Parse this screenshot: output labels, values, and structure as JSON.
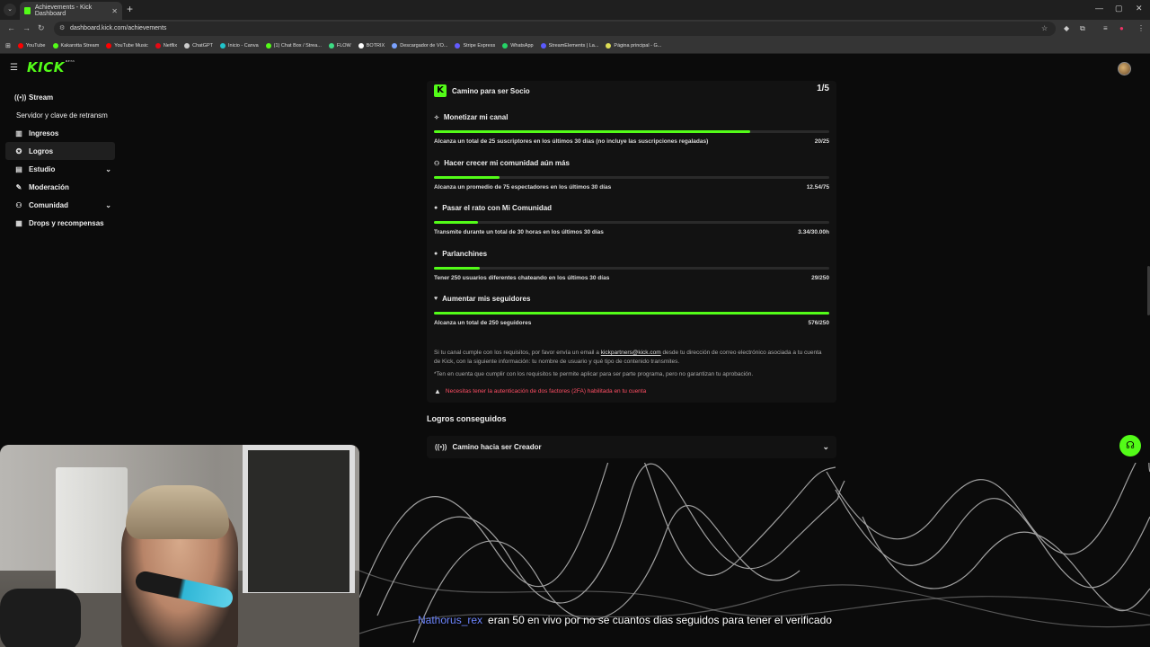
{
  "browser": {
    "tab_title": "Achievements - Kick Dashboard",
    "url": "dashboard.kick.com/achievements",
    "bookmarks": [
      {
        "label": "YouTube",
        "color": "#ff0000"
      },
      {
        "label": "Kakarotta Stream",
        "color": "#53fc18"
      },
      {
        "label": "YouTube Music",
        "color": "#ff0000"
      },
      {
        "label": "Netflix",
        "color": "#e50914"
      },
      {
        "label": "ChatGPT",
        "color": "#cccccc"
      },
      {
        "label": "Inicio - Canva",
        "color": "#20c4cb"
      },
      {
        "label": "(1) Chat Box / Strea...",
        "color": "#53fc18"
      },
      {
        "label": "FLOW",
        "color": "#3ddc84"
      },
      {
        "label": "BOTRIX",
        "color": "#ffffff"
      },
      {
        "label": "Descargador de VO...",
        "color": "#7aa2ff"
      },
      {
        "label": "Stripe Express",
        "color": "#635bff"
      },
      {
        "label": "WhatsApp",
        "color": "#25d366"
      },
      {
        "label": "StreamElements | La...",
        "color": "#5a5aff"
      },
      {
        "label": "Página principal - G...",
        "color": "#dddd55"
      }
    ]
  },
  "app": {
    "logo": "KICK",
    "logo_badge": "BETA",
    "accent": "#53fc18"
  },
  "sidebar": {
    "items": [
      {
        "label": "Stream",
        "icon": "broadcast-icon"
      },
      {
        "label": "Servidor y clave de retransm",
        "icon": ""
      },
      {
        "label": "Ingresos",
        "icon": "chart-icon"
      },
      {
        "label": "Logros",
        "icon": "trophy-icon"
      },
      {
        "label": "Estudio",
        "icon": "studio-icon"
      },
      {
        "label": "Moderación",
        "icon": "wrench-icon"
      },
      {
        "label": "Comunidad",
        "icon": "community-icon"
      },
      {
        "label": "Drops y recompensas",
        "icon": "gift-icon"
      }
    ]
  },
  "partner": {
    "title": "Camino para ser Socio",
    "count": "1/5",
    "achievements": [
      {
        "title": "Monetizar mi canal",
        "desc": "Alcanza un total de 25 suscriptores en los últimos 30 días (no incluye las suscripciones regaladas)",
        "value": "20/25",
        "progress": 0.8
      },
      {
        "title": "Hacer crecer mi comunidad aún más",
        "desc": "Alcanza un promedio de 75 espectadores en los últimos 30 días",
        "value": "12.54/75",
        "progress": 0.167
      },
      {
        "title": "Pasar el rato con Mi Comunidad",
        "desc": "Transmite durante un total de 30 horas en los últimos 30 días",
        "value": "3.34/30.00h",
        "progress": 0.111
      },
      {
        "title": "Parlanchines",
        "desc": "Tener 250 usuarios diferentes chateando en los últimos 30 días",
        "value": "29/250",
        "progress": 0.116
      },
      {
        "title": "Aumentar mis seguidores",
        "desc": "Alcanza un total de 250 seguidores",
        "value": "576/250",
        "progress": 1.0
      }
    ],
    "note_prefix": "Si tu canal cumple con los requisitos, por favor envía un email a ",
    "note_email": "kickpartners@kick.com",
    "note_suffix": " desde tu dirección de correo electrónico asociada a tu cuenta de Kick, con la siguiente información: tu nombre de usuario y qué tipo de contenido transmites.",
    "note2": "*Ten en cuenta que cumplir con los requisitos te permite aplicar para ser parte programa, pero no garantizan tu aprobación.",
    "warning": "Necesitas tener la autenticación de dos factores (2FA) habilitada en tu cuenta",
    "warning_color": "#ff4e64"
  },
  "completed": {
    "heading": "Logros conseguidos",
    "accordion_label": "Camino hacia ser Creador"
  },
  "chat": {
    "user": "Nathorus_rex",
    "message": "eran 50 en vivo por no se cuantos dias seguidos para tener el verificado",
    "user_color": "#6e86ff"
  }
}
